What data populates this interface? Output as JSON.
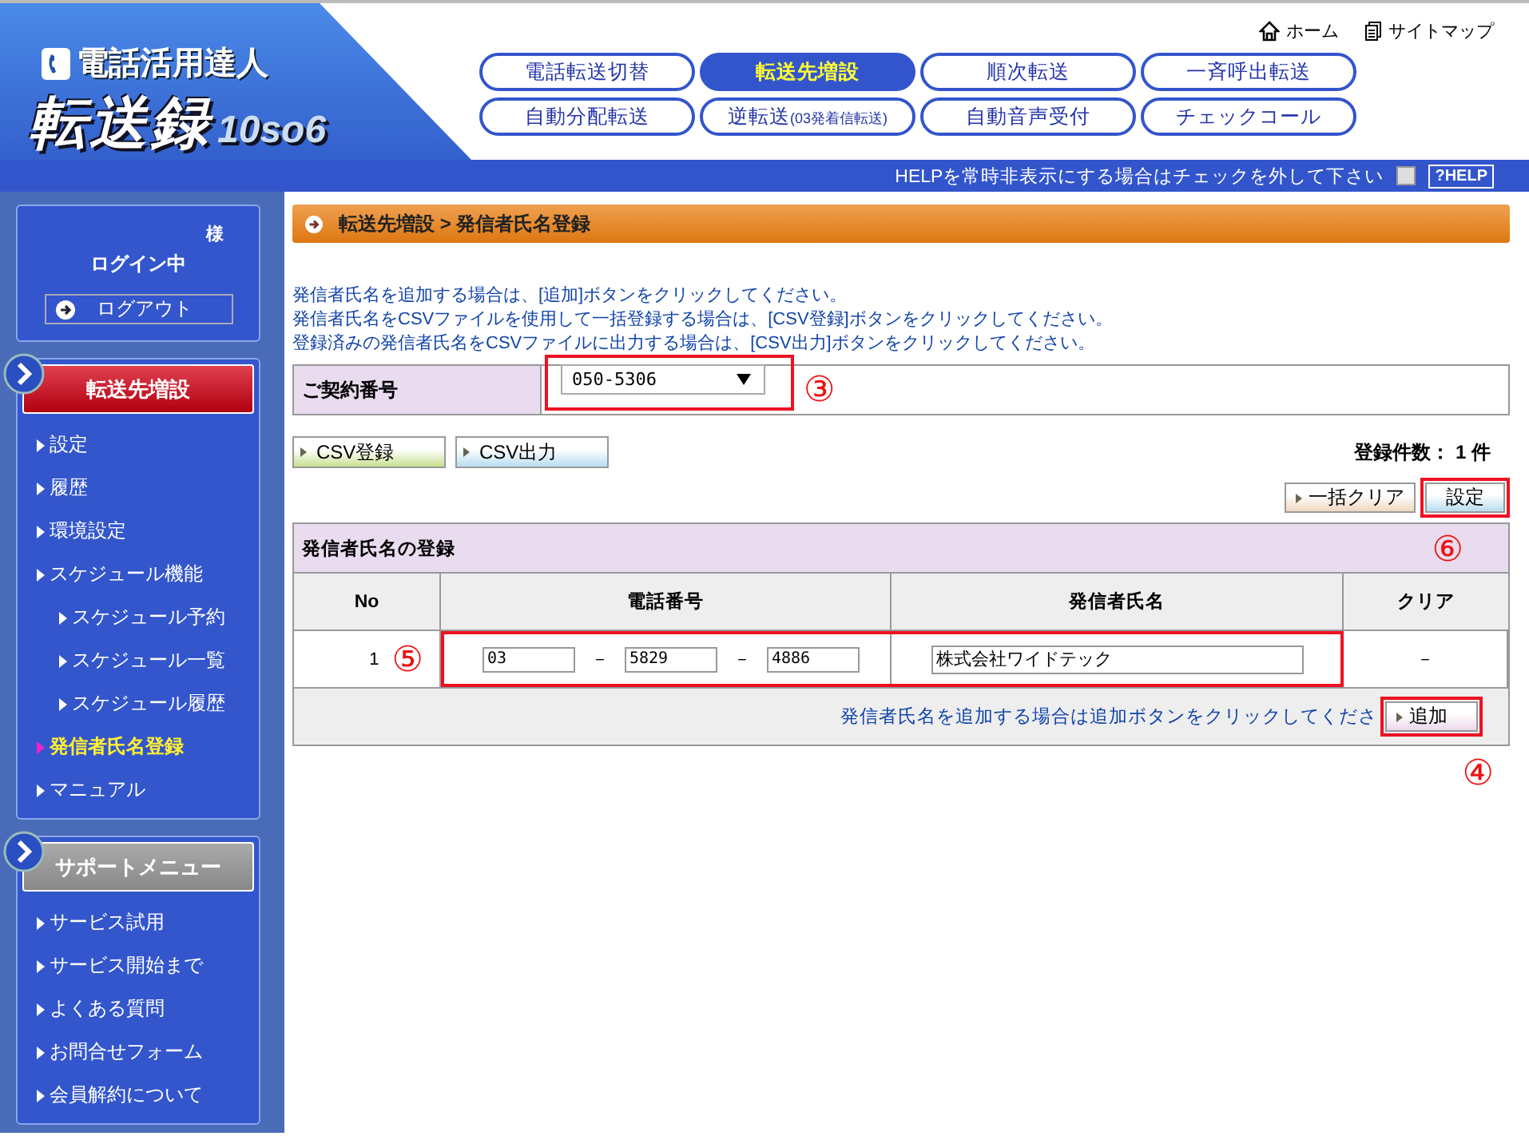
{
  "header": {
    "logo": {
      "tagline": "電話活用達人",
      "title": "転送録",
      "version": "10so6"
    },
    "top_links": [
      {
        "kind": "home",
        "label": "ホーム"
      },
      {
        "kind": "sitemap",
        "label": "サイトマップ"
      }
    ],
    "nav": [
      {
        "label": "電話転送切替",
        "selected": false
      },
      {
        "label": "転送先増設",
        "selected": true
      },
      {
        "label": "順次転送",
        "selected": false
      },
      {
        "label": "一斉呼出転送",
        "selected": false
      },
      {
        "label": "自動分配転送",
        "selected": false
      },
      {
        "label": "逆転送",
        "note": "(03発着信転送)",
        "selected": false
      },
      {
        "label": "自動音声受付",
        "selected": false
      },
      {
        "label": "チェックコール",
        "selected": false
      }
    ],
    "help_bar": {
      "text": "HELPを常時非表示にする場合はチェックを外して下さい",
      "checked": false,
      "button": "?HELP"
    }
  },
  "sidebar": {
    "login": {
      "suffix": "様",
      "status": "ログイン中",
      "logout": "ログアウト"
    },
    "menus": [
      {
        "title": "転送先増設",
        "kind": "primary",
        "items": [
          {
            "label": "設定",
            "selected": false
          },
          {
            "label": "履歴",
            "selected": false
          },
          {
            "label": "環境設定",
            "selected": false
          },
          {
            "label": "スケジュール機能",
            "selected": false,
            "children": [
              {
                "label": "スケジュール予約",
                "selected": false
              },
              {
                "label": "スケジュール一覧",
                "selected": false
              },
              {
                "label": "スケジュール履歴",
                "selected": false
              }
            ]
          },
          {
            "label": "発信者氏名登録",
            "selected": true
          },
          {
            "label": "マニュアル",
            "selected": false
          }
        ]
      },
      {
        "title": "サポートメニュー",
        "kind": "secondary",
        "items": [
          {
            "label": "サービス試用",
            "selected": false
          },
          {
            "label": "サービス開始まで",
            "selected": false
          },
          {
            "label": "よくある質問",
            "selected": false
          },
          {
            "label": "お問合せフォーム",
            "selected": false
          },
          {
            "label": "会員解約について",
            "selected": false
          }
        ]
      }
    ]
  },
  "content": {
    "breadcrumb": "転送先増設 > 発信者氏名登録",
    "instructions": [
      "発信者氏名を追加する場合は、[追加]ボタンをクリックしてください。",
      "発信者氏名をCSVファイルを使用して一括登録する場合は、[CSV登録]ボタンをクリックしてください。",
      "登録済みの発信者氏名をCSVファイルに出力する場合は、[CSV出力]ボタンをクリックしてください。"
    ],
    "contract": {
      "label": "ご契約番号",
      "value": "050-5306",
      "highlighted": true,
      "marker": "③"
    },
    "csv_buttons": [
      {
        "kind": "import",
        "label": "CSV登録"
      },
      {
        "kind": "export",
        "label": "CSV出力"
      }
    ],
    "count": {
      "label": "登録件数：",
      "value": "1",
      "unit": "件"
    },
    "clear_all_button": "一括クリア",
    "set_button": {
      "label": "設定",
      "highlighted": true,
      "marker": "⑥"
    },
    "table": {
      "title": "発信者氏名の登録",
      "columns": [
        "No",
        "電話番号",
        "発信者氏名",
        "クリア"
      ],
      "rows": [
        {
          "no": "1",
          "marker": "⑤",
          "highlighted": true,
          "phone": [
            "03",
            "5829",
            "4886"
          ],
          "separator": "－",
          "name": "株式会社ワイドテック",
          "clear": "－"
        }
      ],
      "hint": "発信者氏名を追加する場合は追加ボタンをクリックしてくださ",
      "add_button": {
        "label": "追加",
        "highlighted": true,
        "marker": "④"
      }
    }
  }
}
